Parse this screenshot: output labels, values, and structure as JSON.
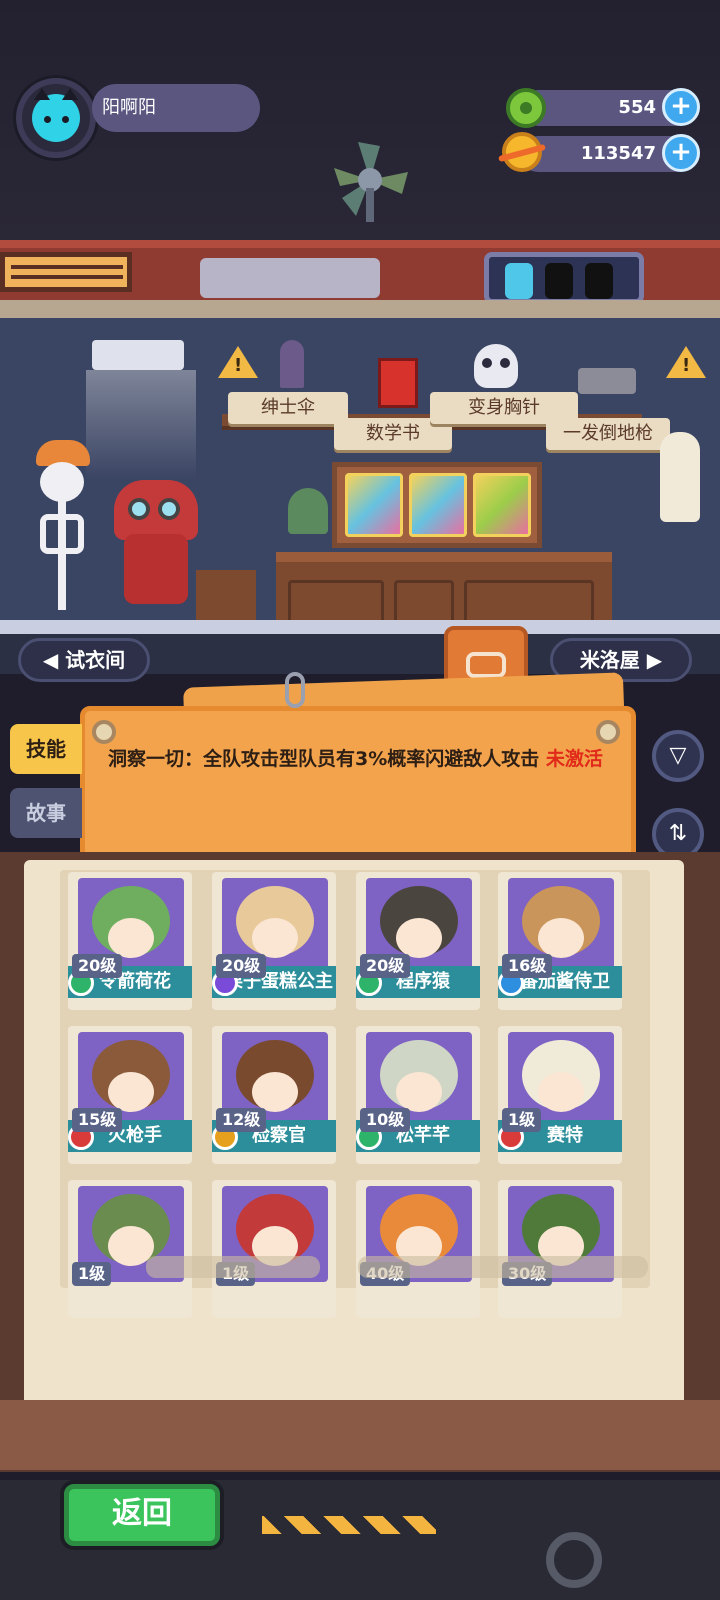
{
  "player": {
    "name": "阳啊阳"
  },
  "currency": {
    "gems": "554",
    "coins": "113547",
    "plus_symbol": "+"
  },
  "warning_symbol": "!",
  "shelf_items": [
    "绅士伞",
    "数学书",
    "变身胸针",
    "一发倒地枪"
  ],
  "rooms": {
    "left": "试衣间",
    "right": "米洛屋"
  },
  "side_tabs": {
    "skill": "技能",
    "story": "故事"
  },
  "skill_panel": {
    "text": "洞察一切：全队攻击型队员有3%概率闪避敌人攻击",
    "status": "未激活"
  },
  "characters": [
    {
      "level": "20级",
      "name": "令箭荷花",
      "badge_color": "#2db36a"
    },
    {
      "level": "20级",
      "name": "栗子蛋糕公主",
      "badge_color": "#7a4bd8"
    },
    {
      "level": "20级",
      "name": "程序猿",
      "badge_color": "#2db36a"
    },
    {
      "level": "16级",
      "name": "番茄酱侍卫",
      "badge_color": "#2e8fe0"
    },
    {
      "level": "15级",
      "name": "火枪手",
      "badge_color": "#d93a3a"
    },
    {
      "level": "12级",
      "name": "检察官",
      "badge_color": "#e6a01e"
    },
    {
      "level": "10级",
      "name": "松芊芊",
      "badge_color": "#2db36a"
    },
    {
      "level": "1级",
      "name": "赛特",
      "badge_color": "#d93a3a"
    },
    {
      "level": "1级",
      "name": "",
      "badge_color": ""
    },
    {
      "level": "1级",
      "name": "",
      "badge_color": ""
    },
    {
      "level": "40级",
      "name": "",
      "badge_color": ""
    },
    {
      "level": "30级",
      "name": "",
      "badge_color": ""
    }
  ],
  "buttons": {
    "back": "返回"
  },
  "colors": {
    "accent_orange": "#f3a34c",
    "card_teal": "#2c8e9a",
    "back_green": "#3cc45c",
    "plus_blue": "#3fa8ee"
  }
}
